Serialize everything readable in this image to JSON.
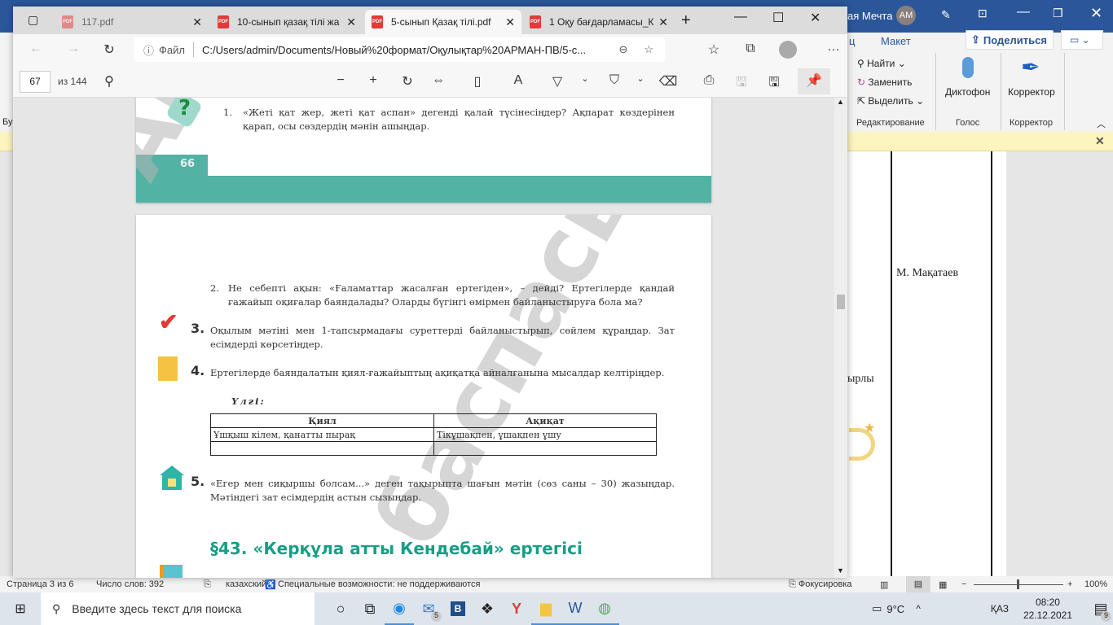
{
  "word": {
    "title_user": "ая Мечта",
    "avatar": "АМ",
    "tab_partial": "ц",
    "tab_layout": "Макет",
    "share": "Поделиться",
    "find": "Найти",
    "replace": "Заменить",
    "select": "Выделить",
    "group_editing": "Редактирование",
    "dictate": "Диктофон",
    "group_voice": "Голос",
    "editor": "Корректор",
    "group_editor": "Корректор",
    "doc_text1": "М. Мақатаев",
    "doc_text2": "ырлы",
    "left_partial": "Бу",
    "status": {
      "page": "Страница 3 из 6",
      "words": "Число слов: 392",
      "lang": "казахский",
      "access": "Специальные возможности: не поддерживаются",
      "focus": "Фокусировка",
      "zoom": "100%"
    }
  },
  "edge": {
    "tabs": [
      {
        "label": "117.pdf"
      },
      {
        "label": "10-сынып қазақ тілі жа"
      },
      {
        "label": "5-сынып Қазақ тілі.pdf",
        "active": true
      },
      {
        "label": "1 Оқу бағдарламасы_К"
      }
    ],
    "file_label": "Файл",
    "url": "C:/Users/admin/Documents/Новый%20формат/Оқулықтар%20АРМАН-ПВ/5-с...",
    "page_current": "67",
    "page_total": "из 144"
  },
  "pdf": {
    "page_num": "66",
    "watermark1": "АР",
    "watermark2": "баспасы",
    "q1": "«Жеті қат жер, жеті қат аспан» дегенді қалай түсінесіңдер? Ақпарат көздерінен қарап, осы сөздердің мәнін ашыңдар.",
    "q1_num": "1.",
    "q2_num": "2.",
    "q2": "Не себепті ақын: «Ғаламаттар жасалған ертегіден», – дейді? Ертегілерде қандай ғажайып оқиғалар баяндалады? Оларды бүгінгі өмірмен байланыстыруға бола ма?",
    "q3_num": "3.",
    "q3": "Оқылым мәтіні мен 1-тапсырмадағы суреттерді байланыстырып, сөйлем құраңдар. Зат есімдерді көрсетіңдер.",
    "q4_num": "4.",
    "q4": "Ертегілерде баяндалатын қиял-ғажайыптың ақиқатқа айналғанына мысалдар келтіріңдер.",
    "sample": "Үлгі:",
    "table": {
      "headers": [
        "Қиял",
        "Ақиқат"
      ],
      "rows": [
        [
          "Ұшқыш кілем, қанатты пырақ",
          "Тікұшақпен, ұшақпен ұшу"
        ],
        [
          "",
          ""
        ]
      ]
    },
    "q5_num": "5.",
    "q5": "«Егер мен сиқыршы болсам...» деген тақырыпта шағын мәтін (сөз саны – 30) жазыңдар. Мәтіндегі зат есімдердің астын сызыңдар.",
    "section": "§43. «Керқұла атты Кендебай» ертегісі"
  },
  "taskbar": {
    "search_placeholder": "Введите здесь текст для поиска",
    "temp": "9°C",
    "lang": "ҚАЗ",
    "time": "08:20",
    "date": "22.12.2021",
    "mail_badge": "5",
    "notif_badge": "9"
  }
}
